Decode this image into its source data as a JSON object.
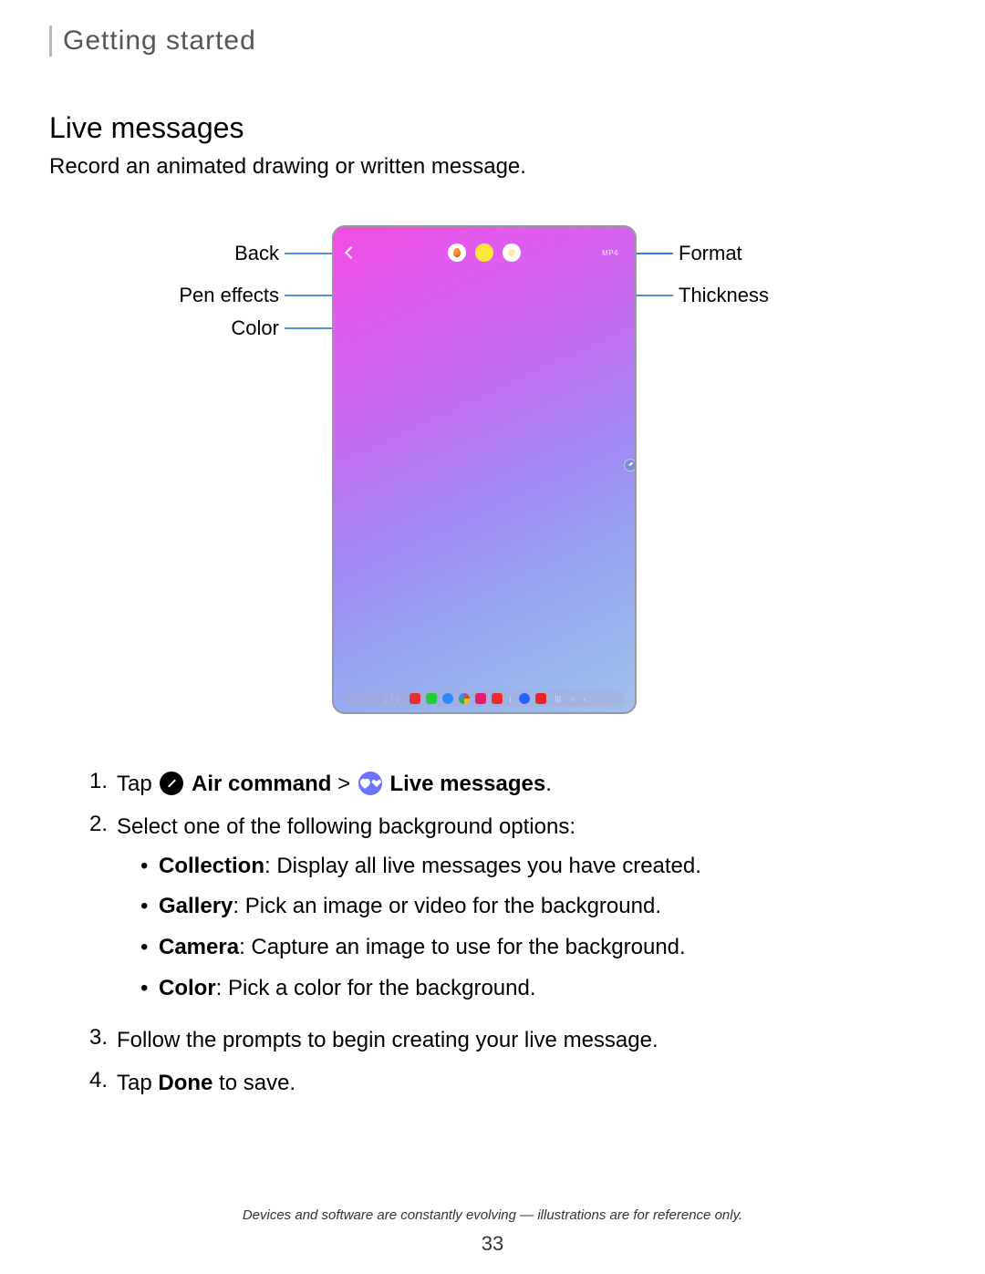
{
  "section": "Getting started",
  "title": "Live messages",
  "subtitle": "Record an animated drawing or written message.",
  "callouts": {
    "back": "Back",
    "pen_effects": "Pen effects",
    "color": "Color",
    "format": "Format",
    "thickness": "Thickness"
  },
  "device": {
    "format_badge": "MP4"
  },
  "steps": {
    "s1_num": "1.",
    "s1_pre": "Tap",
    "s1_b1": "Air command",
    "s1_sep": ">",
    "s1_b2": "Live messages",
    "s1_end": ".",
    "s2_num": "2.",
    "s2_text": "Select one of the following background options:",
    "s3_num": "3.",
    "s3_text": "Follow the prompts to begin creating your live message.",
    "s4_num": "4.",
    "s4_pre": "Tap ",
    "s4_bold": "Done",
    "s4_post": " to save."
  },
  "bullets": {
    "b1_bold": "Collection",
    "b1_rest": ": Display all live messages you have created.",
    "b2_bold": "Gallery",
    "b2_rest": ": Pick an image or video for the background.",
    "b3_bold": "Camera",
    "b3_rest": ": Capture an image to use for the background.",
    "b4_bold": "Color",
    "b4_rest": ": Pick a color for the background."
  },
  "footnote": "Devices and software are constantly evolving — illustrations are for reference only.",
  "page_number": "33"
}
